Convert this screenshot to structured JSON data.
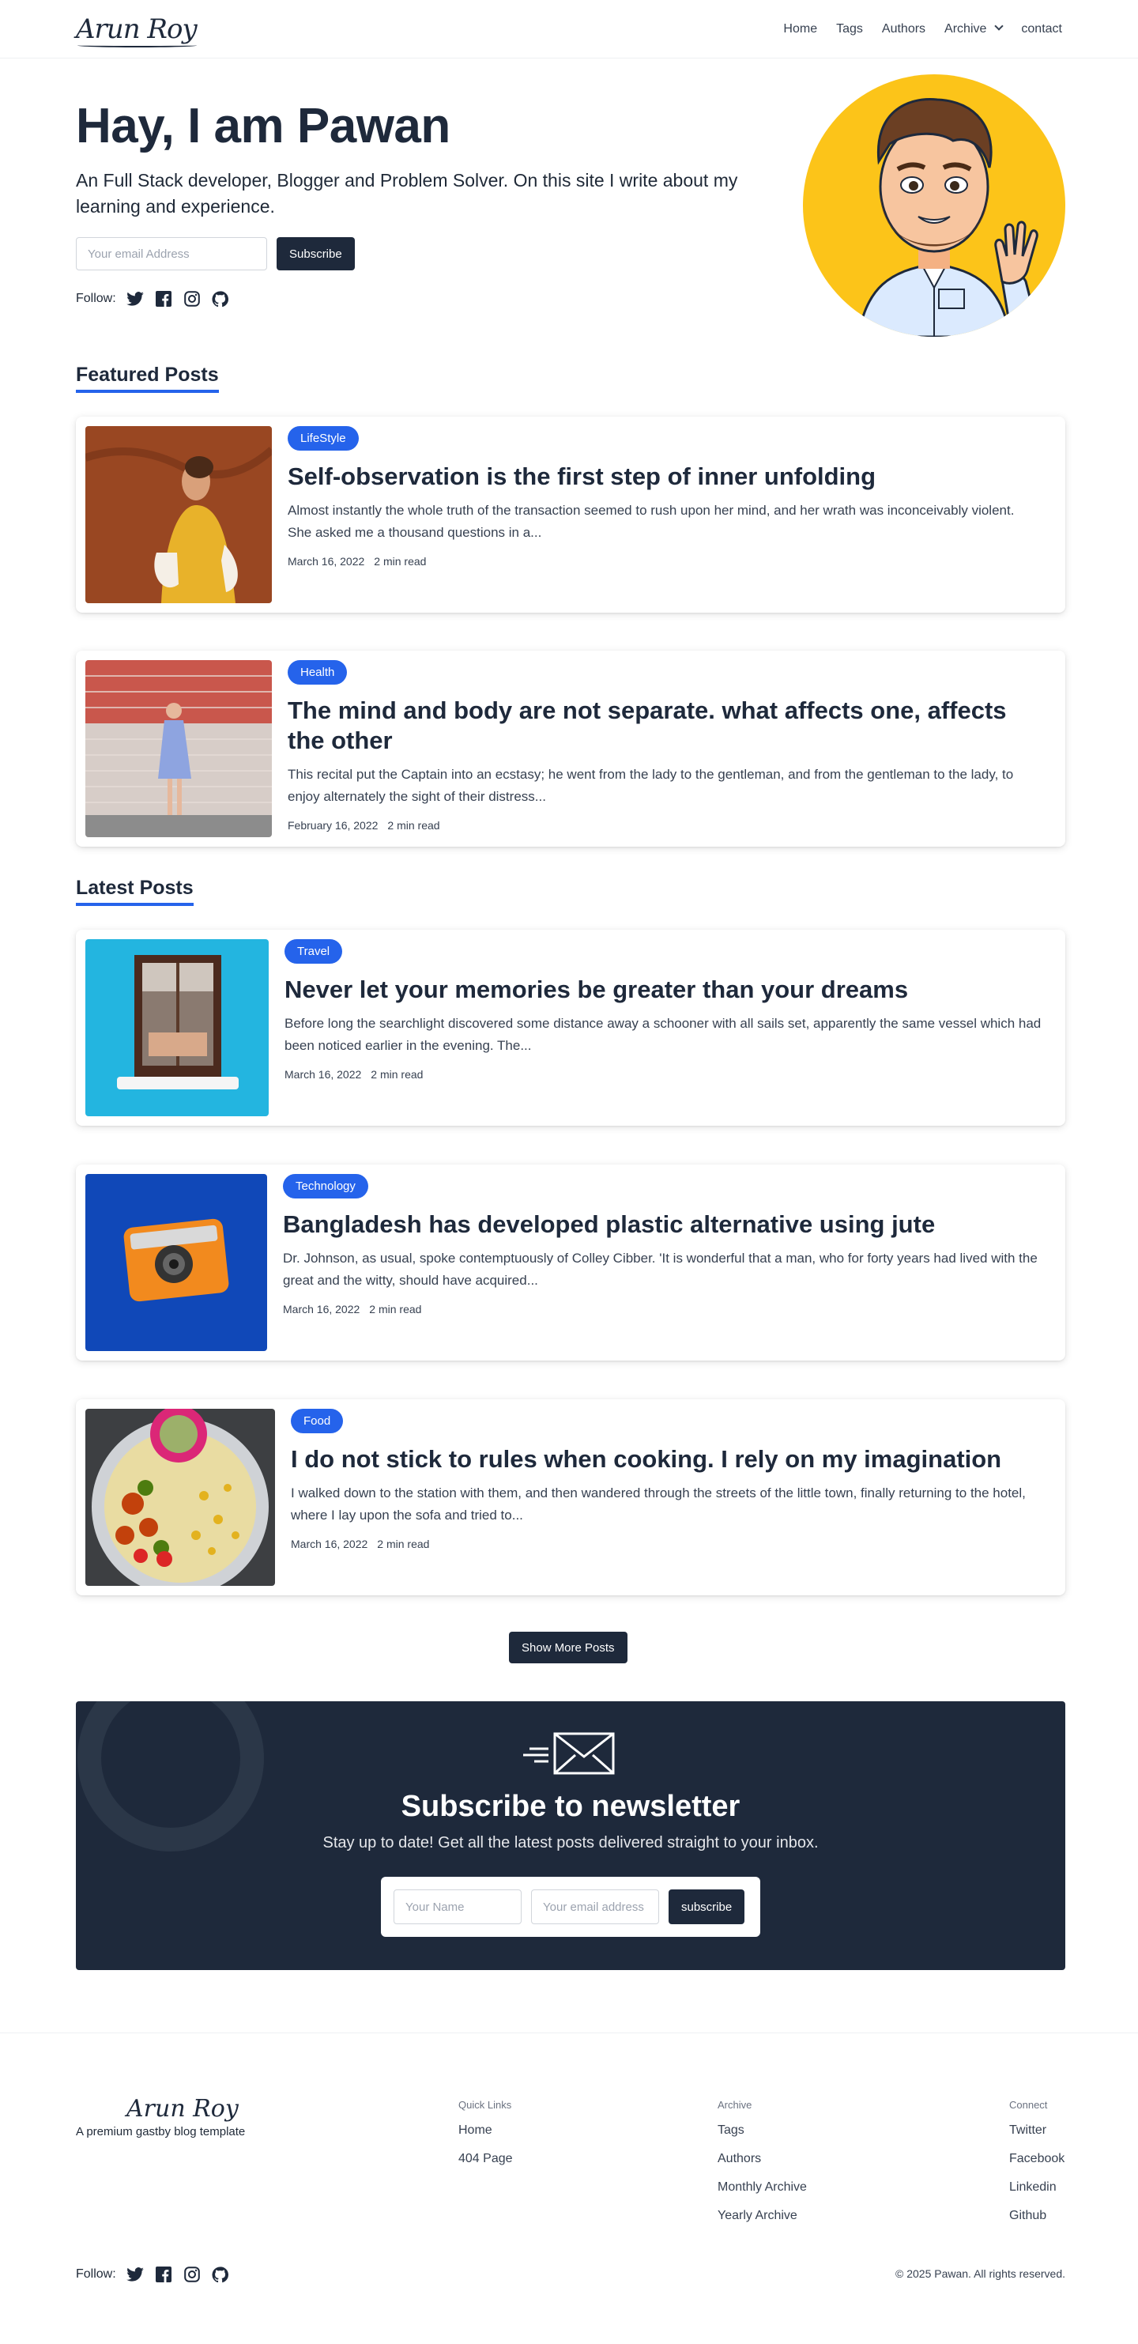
{
  "header": {
    "logo": "Arun Roy",
    "nav": [
      "Home",
      "Tags",
      "Authors",
      "Archive",
      "contact"
    ]
  },
  "hero": {
    "title": "Hay, I am Pawan",
    "intro": "An Full Stack developer, Blogger and Problem Solver. On this site I write about my learning and experience.",
    "email_placeholder": "Your email Address",
    "subscribe_label": "Subscribe",
    "follow_label": "Follow:",
    "social_icons": [
      "twitter-icon",
      "facebook-icon",
      "instagram-icon",
      "github-icon"
    ]
  },
  "featured": {
    "title": "Featured Posts",
    "posts": [
      {
        "tag": "LifeStyle",
        "title": "Self-observation is the first step of inner unfolding",
        "excerpt": "Almost instantly the whole truth of the transaction seemed to rush upon her mind, and her wrath was inconceivably violent. She asked me a thousand questions in a...",
        "date": "March 16, 2022",
        "read": "2 min read"
      },
      {
        "tag": "Health",
        "title": "The mind and body are not separate. what affects one, affects the other",
        "excerpt": "This recital put the Captain into an ecstasy; he went from the lady to the gentleman, and from the gentleman to the lady, to enjoy alternately the sight of their distress...",
        "date": "February 16, 2022",
        "read": "2 min read"
      }
    ]
  },
  "latest": {
    "title": "Latest Posts",
    "posts": [
      {
        "tag": "Travel",
        "title": "Never let your memories be greater than your dreams",
        "excerpt": "Before long the searchlight discovered some distance away a schooner with all sails set, apparently the same vessel which had been noticed earlier in the evening. The...",
        "date": "March 16, 2022",
        "read": "2 min read"
      },
      {
        "tag": "Technology",
        "title": "Bangladesh has developed plastic alternative using jute",
        "excerpt": "Dr. Johnson, as usual, spoke contemptuously of Colley Cibber. 'It is wonderful that a man, who for forty years had lived with the great and the witty, should have acquired...",
        "date": "March 16, 2022",
        "read": "2 min read"
      },
      {
        "tag": "Food",
        "title": "I do not stick to rules when cooking. I rely on my imagination",
        "excerpt": "I walked down to the station with them, and then wandered through the streets of the little town, finally returning to the hotel, where I lay upon the sofa and tried to...",
        "date": "March 16, 2022",
        "read": "2 min read"
      }
    ],
    "show_more_label": "Show More Posts"
  },
  "newsletter": {
    "title": "Subscribe to newsletter",
    "subtitle": "Stay up to date! Get all the latest posts delivered straight to your inbox.",
    "name_placeholder": "Your Name",
    "email_placeholder": "Your email address",
    "button_label": "subscribe"
  },
  "footer": {
    "logo": "Arun Roy",
    "tagline": "A premium gastby blog template",
    "quick_links": {
      "head": "Quick Links",
      "links": [
        "Home",
        "404 Page"
      ]
    },
    "archive": {
      "head": "Archive",
      "links": [
        "Tags",
        "Authors",
        "Monthly Archive",
        "Yearly Archive"
      ]
    },
    "connect": {
      "head": "Connect",
      "links": [
        "Twitter",
        "Facebook",
        "Linkedin",
        "Github"
      ]
    },
    "follow_label": "Follow:",
    "copyright": "© 2025 Pawan. All rights reserved."
  },
  "colors": {
    "primary_dark": "#1e293b",
    "accent_blue": "#2563eb",
    "avatar_bg": "#fcc419"
  }
}
